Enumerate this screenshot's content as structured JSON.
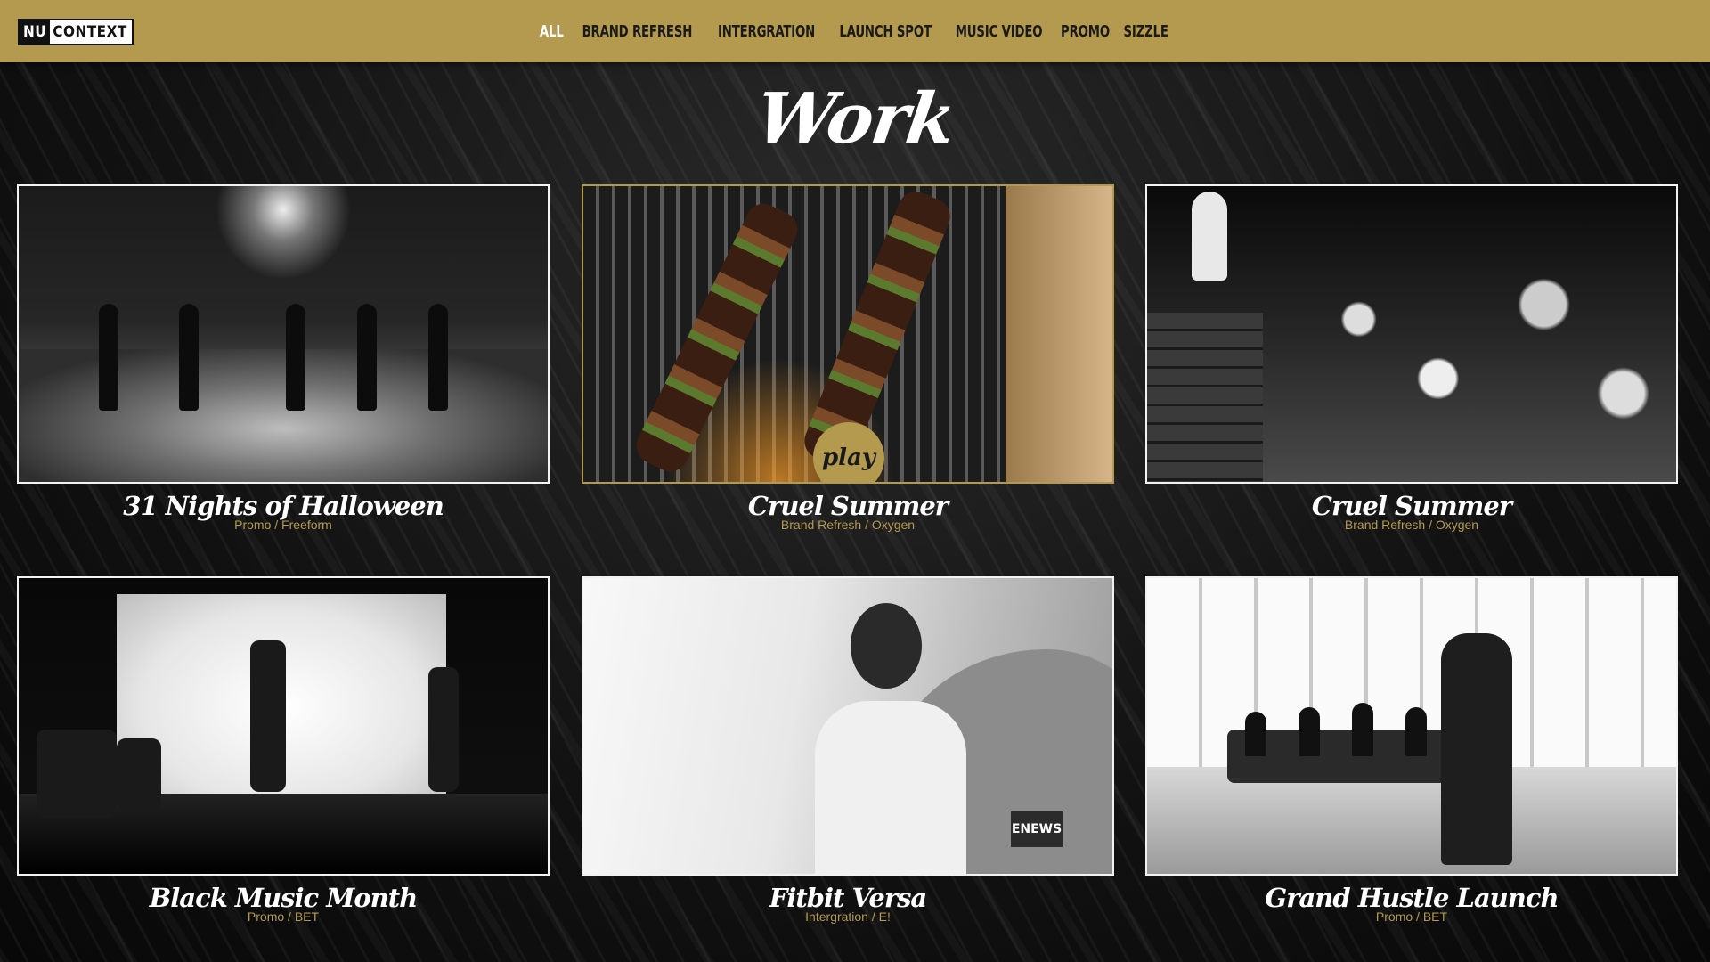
{
  "header": {
    "logo": {
      "part1": "NU",
      "part2": "CONTEXT"
    },
    "nav": [
      {
        "label": "ALL",
        "active": true
      },
      {
        "label": "BRAND REFRESH"
      },
      {
        "label": "INTERGRATION"
      },
      {
        "label": "LAUNCH SPOT"
      },
      {
        "label": "MUSIC VIDEO"
      },
      {
        "label": "PROMO"
      },
      {
        "label": "SIZZLE"
      }
    ]
  },
  "page": {
    "title": "Work"
  },
  "projects": [
    {
      "title": "31 Nights of Halloween",
      "meta": "Promo / Freeform"
    },
    {
      "title": "Cruel Summer",
      "meta": "Brand Refresh / Oxygen",
      "play_label": "play"
    },
    {
      "title": "Cruel Summer",
      "meta": "Brand Refresh / Oxygen"
    },
    {
      "title": "Black Music Month",
      "meta": "Promo / BET"
    },
    {
      "title": "Fitbit Versa",
      "meta": "Intergration / E!",
      "badge": "ENEWS"
    },
    {
      "title": "Grand Hustle Launch",
      "meta": "Promo / BET"
    }
  ],
  "colors": {
    "accent": "#b39a4f",
    "background": "#0d0d0d",
    "text": "#ffffff"
  }
}
